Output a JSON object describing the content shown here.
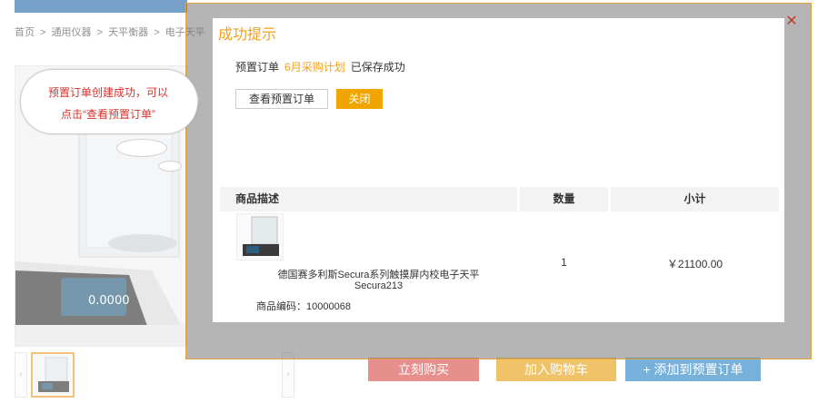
{
  "breadcrumb": [
    "首页",
    ">",
    "通用仪器",
    ">",
    "天平衡器",
    ">",
    "电子天平"
  ],
  "page_buttons": {
    "buy": "立刻购买",
    "cart": "加入购物车",
    "preorder": "+ 添加到预置订单"
  },
  "thumbs": {
    "prev": "‹",
    "next": "›"
  },
  "tooltip": {
    "line1": "预置订单创建成功，可以",
    "line2": "点击“查看预置订单”"
  },
  "modal": {
    "title": "成功提示",
    "close_icon": "✕",
    "message": {
      "prefix": "预置订单",
      "plan_name": "6月采购计划",
      "suffix": "已保存成功"
    },
    "view_button": "查看预置订单",
    "close_button": "关闭",
    "table": {
      "headers": [
        "商品描述",
        "数量",
        "小计"
      ],
      "rows": [
        {
          "name_line1": "德国赛多利斯Secura系列触摸屏内校电子天平",
          "name_line2": "Secura213",
          "code": "商品编码：10000068",
          "quantity": "1",
          "subtotal": "￥21100.00"
        }
      ]
    }
  },
  "colors": {
    "accent": "#f0a020",
    "tooltip_text": "#d9302b",
    "frame": "#e3a53b"
  }
}
